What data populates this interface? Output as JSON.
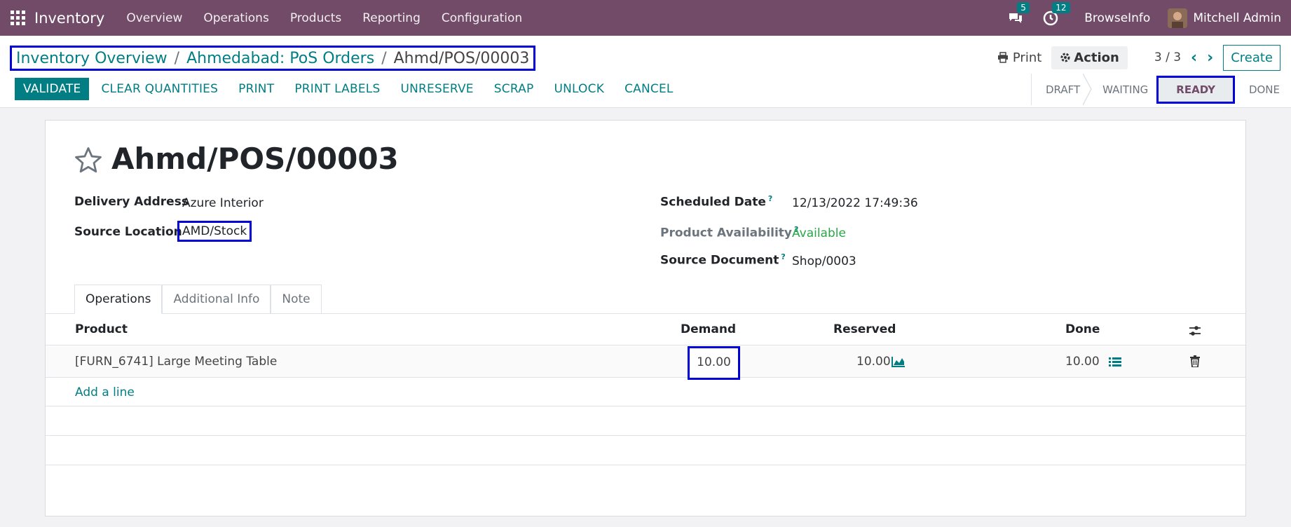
{
  "navbar": {
    "app_name": "Inventory",
    "menu": [
      "Overview",
      "Operations",
      "Products",
      "Reporting",
      "Configuration"
    ],
    "messages_count": "5",
    "activities_count": "12",
    "company": "BrowseInfo",
    "user": "Mitchell Admin",
    "bg_color": "#714b67"
  },
  "breadcrumb": {
    "items": [
      "Inventory Overview",
      "Ahmedabad: PoS Orders"
    ],
    "current": "Ahmd/POS/00003",
    "separator": "/"
  },
  "control": {
    "print_label": "Print",
    "action_label": "Action",
    "pager": "3 / 3",
    "create_label": "Create"
  },
  "buttons": [
    "VALIDATE",
    "CLEAR QUANTITIES",
    "PRINT",
    "PRINT LABELS",
    "UNRESERVE",
    "SCRAP",
    "UNLOCK",
    "CANCEL"
  ],
  "statusbar": {
    "stages": [
      "DRAFT",
      "WAITING",
      "READY",
      "DONE"
    ],
    "active": "READY"
  },
  "record": {
    "title": "Ahmd/POS/00003",
    "delivery_address_label": "Delivery Address",
    "delivery_address": "Azure Interior",
    "source_location_label": "Source Location",
    "source_location": "AMD/Stock",
    "scheduled_date_label": "Scheduled Date",
    "scheduled_date": "12/13/2022 17:49:36",
    "availability_label": "Product Availability",
    "availability": "Available",
    "source_document_label": "Source Document",
    "source_document": "Shop/0003",
    "help_mark": "?"
  },
  "tabs": [
    "Operations",
    "Additional Info",
    "Note"
  ],
  "table": {
    "columns": [
      "Product",
      "Demand",
      "Reserved",
      "Done"
    ],
    "rows": [
      {
        "product": "[FURN_6741] Large Meeting Table",
        "demand": "10.00",
        "reserved": "10.00",
        "done": "10.00"
      }
    ],
    "add_line": "Add a line"
  },
  "colors": {
    "accent": "#017e84",
    "highlight_box": "#0000d8",
    "available": "#28a745"
  }
}
